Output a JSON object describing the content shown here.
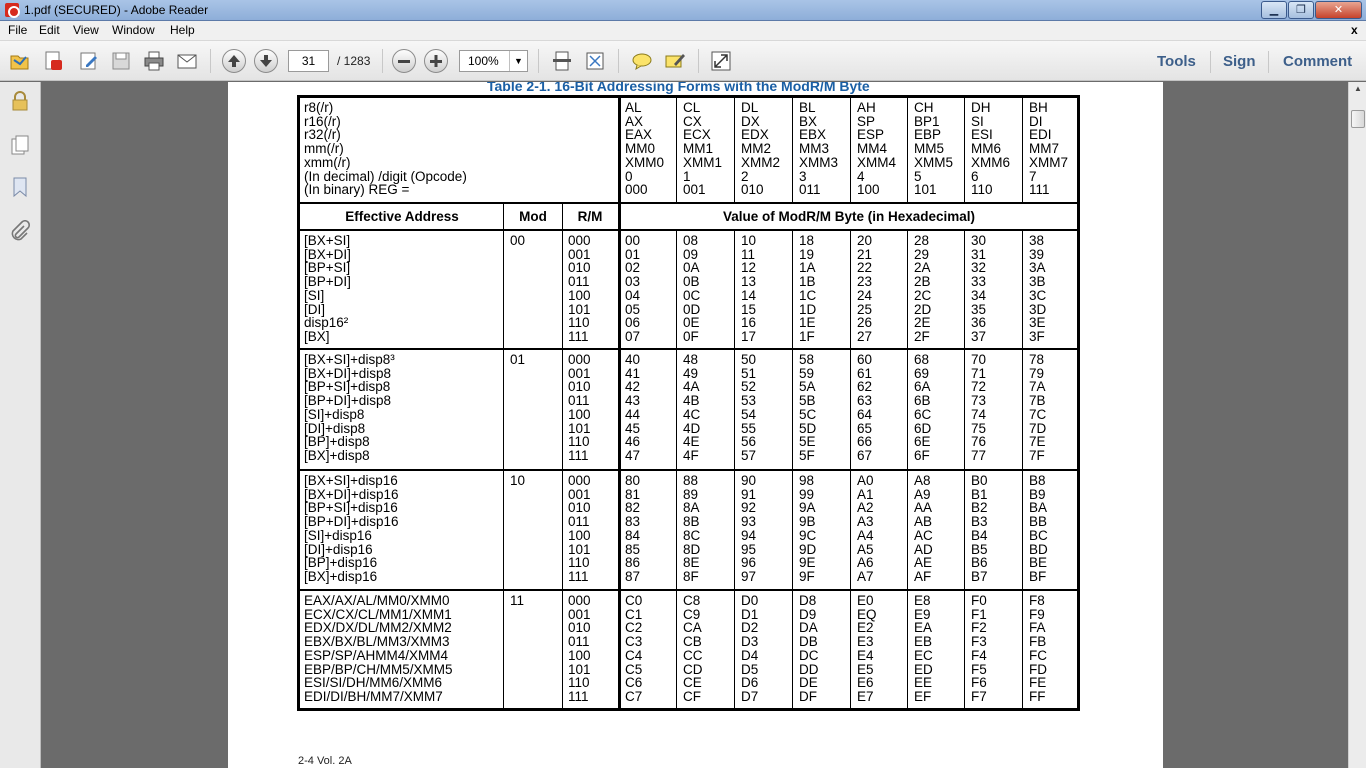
{
  "window": {
    "title": "1.pdf (SECURED) - Adobe Reader",
    "minimize": "▁",
    "maximize": "❐",
    "close": "✕"
  },
  "menu": {
    "items": [
      "File",
      "Edit",
      "View",
      "Window",
      "Help"
    ],
    "close_doc": "x"
  },
  "toolbar": {
    "page_current": "31",
    "page_total": "/ 1283",
    "zoom": "100%",
    "links": [
      "Tools",
      "Sign",
      "Comment"
    ]
  },
  "document": {
    "caption": "Table 2-1.  16-Bit Addressing Forms with the ModR/M Byte",
    "footer": "2-4   Vol. 2A",
    "reg_header": {
      "labels": [
        "r8(/r)",
        "r16(/r)",
        "r32(/r)",
        "mm(/r)",
        "xmm(/r)",
        "(In decimal) /digit (Opcode)",
        "(In binary) REG ="
      ],
      "columns": [
        [
          "AL",
          "AX",
          "EAX",
          "MM0",
          "XMM0",
          "0",
          "000"
        ],
        [
          "CL",
          "CX",
          "ECX",
          "MM1",
          "XMM1",
          "1",
          "001"
        ],
        [
          "DL",
          "DX",
          "EDX",
          "MM2",
          "XMM2",
          "2",
          "010"
        ],
        [
          "BL",
          "BX",
          "EBX",
          "MM3",
          "XMM3",
          "3",
          "011"
        ],
        [
          "AH",
          "SP",
          "ESP",
          "MM4",
          "XMM4",
          "4",
          "100"
        ],
        [
          "CH",
          "BP1",
          "EBP",
          "MM5",
          "XMM5",
          "5",
          "101"
        ],
        [
          "DH",
          "SI",
          "ESI",
          "MM6",
          "XMM6",
          "6",
          "110"
        ],
        [
          "BH",
          "DI",
          "EDI",
          "MM7",
          "XMM7",
          "7",
          "111"
        ]
      ]
    },
    "col_headers": {
      "ea": "Effective Address",
      "mod": "Mod",
      "rm": "R/M",
      "value": "Value of ModR/M Byte (in Hexadecimal)"
    },
    "groups": [
      {
        "mod": "00",
        "ea": [
          "[BX+SI]",
          "[BX+DI]",
          "[BP+SI]",
          "[BP+DI]",
          "[SI]",
          "[DI]",
          "disp16²",
          "[BX]"
        ],
        "rm": [
          "000",
          "001",
          "010",
          "011",
          "100",
          "101",
          "110",
          "111"
        ],
        "values": [
          [
            "00",
            "08",
            "10",
            "18",
            "20",
            "28",
            "30",
            "38"
          ],
          [
            "01",
            "09",
            "11",
            "19",
            "21",
            "29",
            "31",
            "39"
          ],
          [
            "02",
            "0A",
            "12",
            "1A",
            "22",
            "2A",
            "32",
            "3A"
          ],
          [
            "03",
            "0B",
            "13",
            "1B",
            "23",
            "2B",
            "33",
            "3B"
          ],
          [
            "04",
            "0C",
            "14",
            "1C",
            "24",
            "2C",
            "34",
            "3C"
          ],
          [
            "05",
            "0D",
            "15",
            "1D",
            "25",
            "2D",
            "35",
            "3D"
          ],
          [
            "06",
            "0E",
            "16",
            "1E",
            "26",
            "2E",
            "36",
            "3E"
          ],
          [
            "07",
            "0F",
            "17",
            "1F",
            "27",
            "2F",
            "37",
            "3F"
          ]
        ]
      },
      {
        "mod": "01",
        "ea": [
          "[BX+SI]+disp8³",
          "[BX+DI]+disp8",
          "[BP+SI]+disp8",
          "[BP+DI]+disp8",
          "[SI]+disp8",
          "[DI]+disp8",
          "[BP]+disp8",
          "[BX]+disp8"
        ],
        "rm": [
          "000",
          "001",
          "010",
          "011",
          "100",
          "101",
          "110",
          "111"
        ],
        "values": [
          [
            "40",
            "48",
            "50",
            "58",
            "60",
            "68",
            "70",
            "78"
          ],
          [
            "41",
            "49",
            "51",
            "59",
            "61",
            "69",
            "71",
            "79"
          ],
          [
            "42",
            "4A",
            "52",
            "5A",
            "62",
            "6A",
            "72",
            "7A"
          ],
          [
            "43",
            "4B",
            "53",
            "5B",
            "63",
            "6B",
            "73",
            "7B"
          ],
          [
            "44",
            "4C",
            "54",
            "5C",
            "64",
            "6C",
            "74",
            "7C"
          ],
          [
            "45",
            "4D",
            "55",
            "5D",
            "65",
            "6D",
            "75",
            "7D"
          ],
          [
            "46",
            "4E",
            "56",
            "5E",
            "66",
            "6E",
            "76",
            "7E"
          ],
          [
            "47",
            "4F",
            "57",
            "5F",
            "67",
            "6F",
            "77",
            "7F"
          ]
        ]
      },
      {
        "mod": "10",
        "ea": [
          "[BX+SI]+disp16",
          "[BX+DI]+disp16",
          "[BP+SI]+disp16",
          "[BP+DI]+disp16",
          "[SI]+disp16",
          "[DI]+disp16",
          "[BP]+disp16",
          "[BX]+disp16"
        ],
        "rm": [
          "000",
          "001",
          "010",
          "011",
          "100",
          "101",
          "110",
          "111"
        ],
        "values": [
          [
            "80",
            "88",
            "90",
            "98",
            "A0",
            "A8",
            "B0",
            "B8"
          ],
          [
            "81",
            "89",
            "91",
            "99",
            "A1",
            "A9",
            "B1",
            "B9"
          ],
          [
            "82",
            "8A",
            "92",
            "9A",
            "A2",
            "AA",
            "B2",
            "BA"
          ],
          [
            "83",
            "8B",
            "93",
            "9B",
            "A3",
            "AB",
            "B3",
            "BB"
          ],
          [
            "84",
            "8C",
            "94",
            "9C",
            "A4",
            "AC",
            "B4",
            "BC"
          ],
          [
            "85",
            "8D",
            "95",
            "9D",
            "A5",
            "AD",
            "B5",
            "BD"
          ],
          [
            "86",
            "8E",
            "96",
            "9E",
            "A6",
            "AE",
            "B6",
            "BE"
          ],
          [
            "87",
            "8F",
            "97",
            "9F",
            "A7",
            "AF",
            "B7",
            "BF"
          ]
        ]
      },
      {
        "mod": "11",
        "ea": [
          "EAX/AX/AL/MM0/XMM0",
          "ECX/CX/CL/MM1/XMM1",
          "EDX/DX/DL/MM2/XMM2",
          "EBX/BX/BL/MM3/XMM3",
          "ESP/SP/AHMM4/XMM4",
          "EBP/BP/CH/MM5/XMM5",
          "ESI/SI/DH/MM6/XMM6",
          "EDI/DI/BH/MM7/XMM7"
        ],
        "rm": [
          "000",
          "001",
          "010",
          "011",
          "100",
          "101",
          "110",
          "111"
        ],
        "values": [
          [
            "C0",
            "C8",
            "D0",
            "D8",
            "E0",
            "E8",
            "F0",
            "F8"
          ],
          [
            "C1",
            "C9",
            "D1",
            "D9",
            "EQ",
            "E9",
            "F1",
            "F9"
          ],
          [
            "C2",
            "CA",
            "D2",
            "DA",
            "E2",
            "EA",
            "F2",
            "FA"
          ],
          [
            "C3",
            "CB",
            "D3",
            "DB",
            "E3",
            "EB",
            "F3",
            "FB"
          ],
          [
            "C4",
            "CC",
            "D4",
            "DC",
            "E4",
            "EC",
            "F4",
            "FC"
          ],
          [
            "C5",
            "CD",
            "D5",
            "DD",
            "E5",
            "ED",
            "F5",
            "FD"
          ],
          [
            "C6",
            "CE",
            "D6",
            "DE",
            "E6",
            "EE",
            "F6",
            "FE"
          ],
          [
            "C7",
            "CF",
            "D7",
            "DF",
            "E7",
            "EF",
            "F7",
            "FF"
          ]
        ]
      }
    ]
  },
  "colors": {
    "caption_blue": "#1a5fa5",
    "doc_bg": "#6b6b6b",
    "link_blue": "#3d5f8a"
  },
  "icons": [
    "pdf-app-icon",
    "open-icon",
    "create-pdf-icon",
    "edit-icon",
    "save-icon",
    "print-icon",
    "email-icon",
    "prev-page-icon",
    "next-page-icon",
    "zoom-out-icon",
    "zoom-in-icon",
    "select-icon",
    "marquee-icon",
    "comment-icon",
    "highlight-icon",
    "fullscreen-icon",
    "lock-icon",
    "pages-icon",
    "bookmark-icon",
    "attachment-icon"
  ]
}
